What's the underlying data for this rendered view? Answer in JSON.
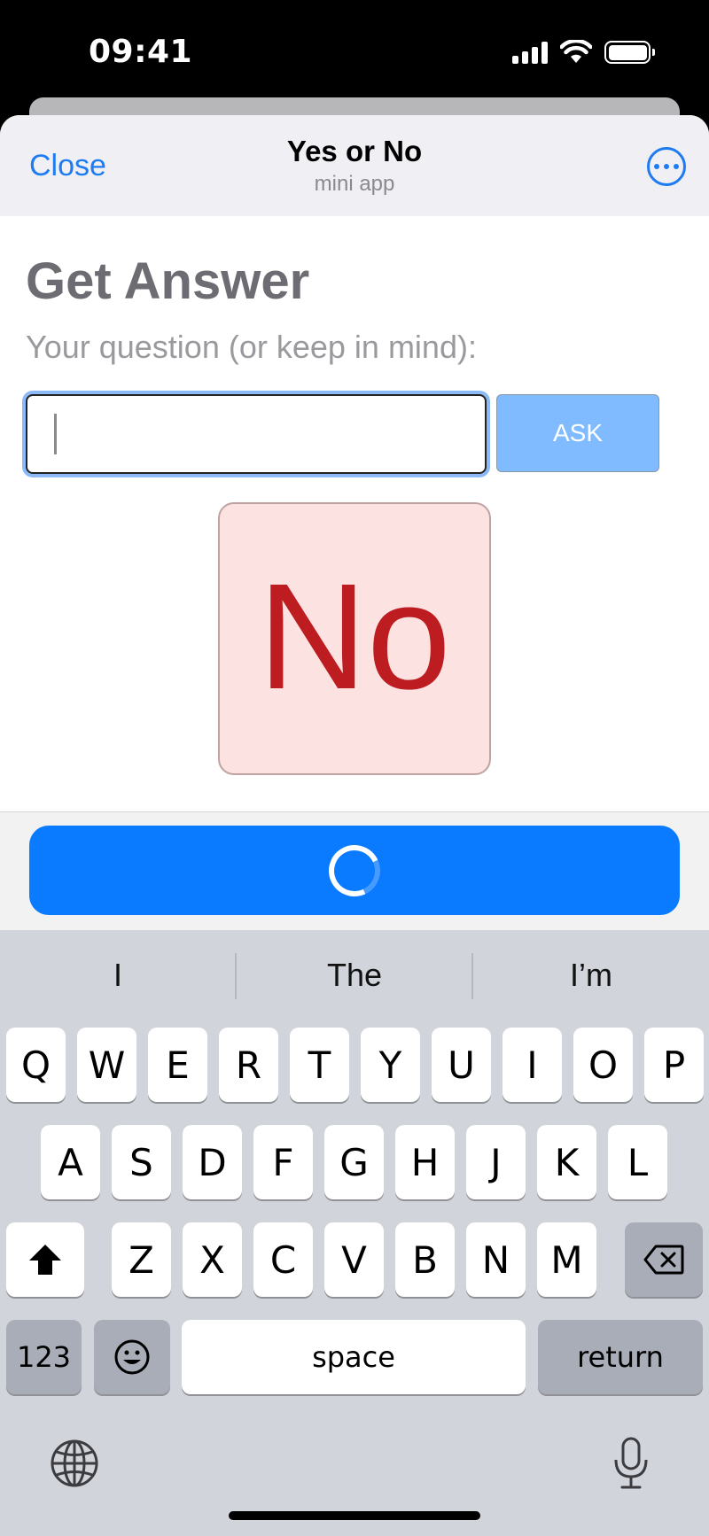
{
  "status_bar": {
    "time": "09:41"
  },
  "nav": {
    "close_label": "Close",
    "title": "Yes or No",
    "subtitle": "mini app",
    "more_icon": "ellipsis-circle-icon"
  },
  "content": {
    "heading": "Get Answer",
    "prompt_label": "Your question (or keep in mind):",
    "question_value": "",
    "ask_label": "ASK",
    "answer": "No"
  },
  "main_button": {
    "state": "loading",
    "icon": "spinner-icon"
  },
  "keyboard": {
    "suggestions": [
      "I",
      "The",
      "I’m"
    ],
    "row1": [
      "Q",
      "W",
      "E",
      "R",
      "T",
      "Y",
      "U",
      "I",
      "O",
      "P"
    ],
    "row2": [
      "A",
      "S",
      "D",
      "F",
      "G",
      "H",
      "J",
      "K",
      "L"
    ],
    "row3": [
      "Z",
      "X",
      "C",
      "V",
      "B",
      "N",
      "M"
    ],
    "numbers_label": "123",
    "space_label": "space",
    "return_label": "return"
  },
  "colors": {
    "accent": "#0a7aff",
    "link": "#1e7cf2",
    "answer_bg": "#fde2e2",
    "answer_text": "#bd1c21",
    "ask_bg": "#80bbff"
  }
}
